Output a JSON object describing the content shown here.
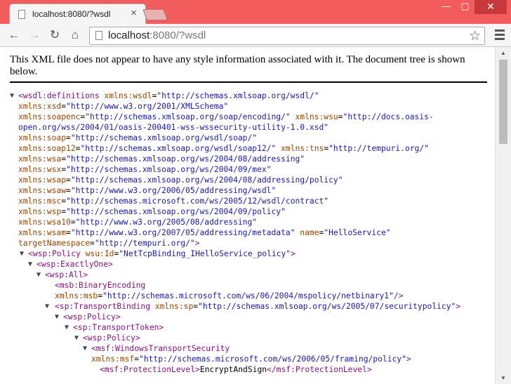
{
  "tab": {
    "title": "localhost:8080/?wsdl",
    "close": "×"
  },
  "window": {
    "minimize": "—",
    "maximize": "▢",
    "close": "✕"
  },
  "nav": {
    "back": "←",
    "forward": "→",
    "reload": "↻",
    "home": "⌂"
  },
  "omnibox": {
    "url_host": "localhost",
    "url_rest": ":8080/?wsdl"
  },
  "notice": "This XML file does not appear to have any style information associated with it. The document tree is shown below.",
  "xml_lines": [
    [
      {
        "t": "tag",
        "s": "<wsdl:definitions"
      },
      {
        "t": "an",
        "s": " xmlns:wsdl"
      },
      {
        "t": "txt",
        "s": "="
      },
      {
        "t": "av",
        "s": "\"http://schemas.xmlsoap.org/wsdl/\""
      }
    ],
    [
      {
        "t": "an",
        "s": "xmlns:xsd"
      },
      {
        "t": "txt",
        "s": "="
      },
      {
        "t": "av",
        "s": "\"http://www.w3.org/2001/XMLSchema\""
      }
    ],
    [
      {
        "t": "an",
        "s": "xmlns:soapenc"
      },
      {
        "t": "txt",
        "s": "="
      },
      {
        "t": "av",
        "s": "\"http://schemas.xmlsoap.org/soap/encoding/\""
      },
      {
        "t": "an",
        "s": " xmlns:wsu"
      },
      {
        "t": "txt",
        "s": "="
      },
      {
        "t": "av",
        "s": "\"http://docs.oasis-"
      }
    ],
    [
      {
        "t": "av",
        "s": "open.org/wss/2004/01/oasis-200401-wss-wssecurity-utility-1.0.xsd\""
      }
    ],
    [
      {
        "t": "an",
        "s": "xmlns:soap"
      },
      {
        "t": "txt",
        "s": "="
      },
      {
        "t": "av",
        "s": "\"http://schemas.xmlsoap.org/wsdl/soap/\""
      }
    ],
    [
      {
        "t": "an",
        "s": "xmlns:soap12"
      },
      {
        "t": "txt",
        "s": "="
      },
      {
        "t": "av",
        "s": "\"http://schemas.xmlsoap.org/wsdl/soap12/\""
      },
      {
        "t": "an",
        "s": " xmlns:tns"
      },
      {
        "t": "txt",
        "s": "="
      },
      {
        "t": "av",
        "s": "\"http://tempuri.org/\""
      }
    ],
    [
      {
        "t": "an",
        "s": "xmlns:wsa"
      },
      {
        "t": "txt",
        "s": "="
      },
      {
        "t": "av",
        "s": "\"http://schemas.xmlsoap.org/ws/2004/08/addressing\""
      }
    ],
    [
      {
        "t": "an",
        "s": "xmlns:wsx"
      },
      {
        "t": "txt",
        "s": "="
      },
      {
        "t": "av",
        "s": "\"http://schemas.xmlsoap.org/ws/2004/09/mex\""
      }
    ],
    [
      {
        "t": "an",
        "s": "xmlns:wsap"
      },
      {
        "t": "txt",
        "s": "="
      },
      {
        "t": "av",
        "s": "\"http://schemas.xmlsoap.org/ws/2004/08/addressing/policy\""
      }
    ],
    [
      {
        "t": "an",
        "s": "xmlns:wsaw"
      },
      {
        "t": "txt",
        "s": "="
      },
      {
        "t": "av",
        "s": "\"http://www.w3.org/2006/05/addressing/wsdl\""
      }
    ],
    [
      {
        "t": "an",
        "s": "xmlns:msc"
      },
      {
        "t": "txt",
        "s": "="
      },
      {
        "t": "av",
        "s": "\"http://schemas.microsoft.com/ws/2005/12/wsdl/contract\""
      }
    ],
    [
      {
        "t": "an",
        "s": "xmlns:wsp"
      },
      {
        "t": "txt",
        "s": "="
      },
      {
        "t": "av",
        "s": "\"http://schemas.xmlsoap.org/ws/2004/09/policy\""
      }
    ],
    [
      {
        "t": "an",
        "s": "xmlns:wsa10"
      },
      {
        "t": "txt",
        "s": "="
      },
      {
        "t": "av",
        "s": "\"http://www.w3.org/2005/08/addressing\""
      }
    ],
    [
      {
        "t": "an",
        "s": "xmlns:wsam"
      },
      {
        "t": "txt",
        "s": "="
      },
      {
        "t": "av",
        "s": "\"http://www.w3.org/2007/05/addressing/metadata\""
      },
      {
        "t": "an",
        "s": " name"
      },
      {
        "t": "txt",
        "s": "="
      },
      {
        "t": "av",
        "s": "\"HelloService\""
      }
    ],
    [
      {
        "t": "an",
        "s": "targetNamespace"
      },
      {
        "t": "txt",
        "s": "="
      },
      {
        "t": "av",
        "s": "\"http://tempuri.org/\""
      },
      {
        "t": "tag",
        "s": ">"
      }
    ],
    [
      {
        "t": "tag",
        "s": "<wsp:Policy"
      },
      {
        "t": "an",
        "s": " wsu:Id"
      },
      {
        "t": "txt",
        "s": "="
      },
      {
        "t": "av",
        "s": "\"NetTcpBinding_IHelloService_policy\""
      },
      {
        "t": "tag",
        "s": ">"
      }
    ],
    [
      {
        "t": "tag",
        "s": "<wsp:ExactlyOne>"
      }
    ],
    [
      {
        "t": "tag",
        "s": "<wsp:All>"
      }
    ],
    [
      {
        "t": "tag",
        "s": "<msb:BinaryEncoding"
      }
    ],
    [
      {
        "t": "an",
        "s": "xmlns:msb"
      },
      {
        "t": "txt",
        "s": "="
      },
      {
        "t": "av",
        "s": "\"http://schemas.microsoft.com/ws/06/2004/mspolicy/netbinary1\""
      },
      {
        "t": "tag",
        "s": "/>"
      }
    ],
    [
      {
        "t": "tag",
        "s": "<sp:TransportBinding"
      },
      {
        "t": "an",
        "s": " xmlns:sp"
      },
      {
        "t": "txt",
        "s": "="
      },
      {
        "t": "av",
        "s": "\"http://schemas.xmlsoap.org/ws/2005/07/securitypolicy\""
      },
      {
        "t": "tag",
        "s": ">"
      }
    ],
    [
      {
        "t": "tag",
        "s": "<wsp:Policy>"
      }
    ],
    [
      {
        "t": "tag",
        "s": "<sp:TransportToken>"
      }
    ],
    [
      {
        "t": "tag",
        "s": "<wsp:Policy>"
      }
    ],
    [
      {
        "t": "tag",
        "s": "<msf:WindowsTransportSecurity"
      }
    ],
    [
      {
        "t": "an",
        "s": "xmlns:msf"
      },
      {
        "t": "txt",
        "s": "="
      },
      {
        "t": "av",
        "s": "\"http://schemas.microsoft.com/ws/2006/05/framing/policy\""
      },
      {
        "t": "tag",
        "s": ">"
      }
    ],
    [
      {
        "t": "tag",
        "s": "<msf:ProtectionLevel>"
      },
      {
        "t": "txt",
        "s": "EncryptAndSign"
      },
      {
        "t": "tag",
        "s": "</msf:ProtectionLevel>"
      }
    ]
  ],
  "expander_glyph": "▼"
}
